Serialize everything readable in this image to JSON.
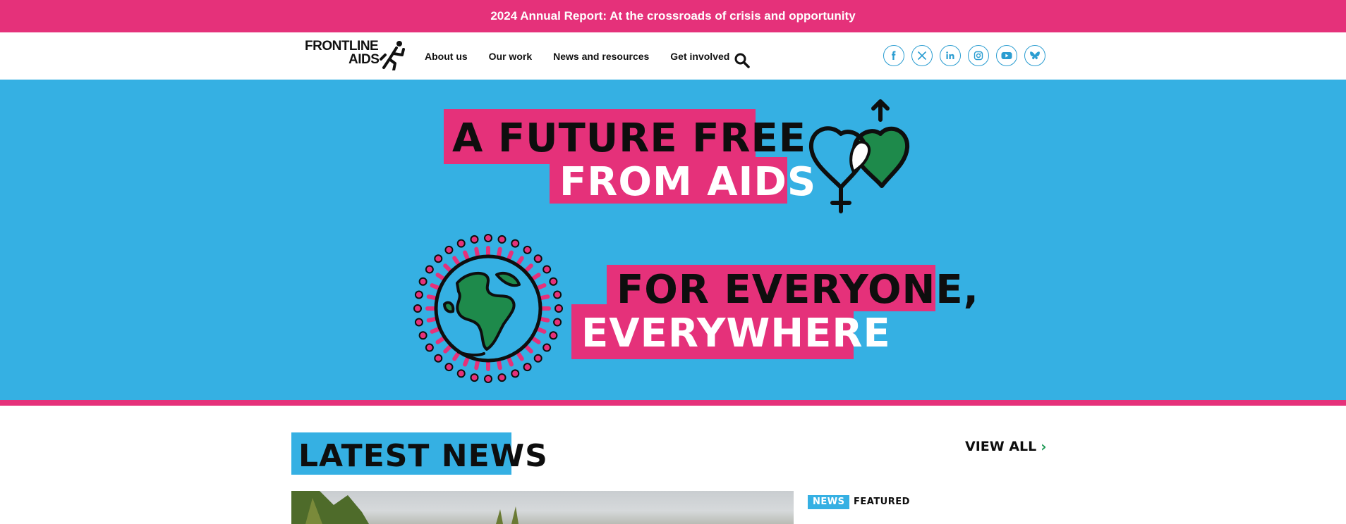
{
  "banner": {
    "text": "2024 Annual Report: At the crossroads of crisis and opportunity"
  },
  "header": {
    "logo": {
      "line1": "FRONTLINE",
      "line2": "AIDS"
    },
    "nav": [
      {
        "label": "About us"
      },
      {
        "label": "Our work"
      },
      {
        "label": "News and resources"
      },
      {
        "label": "Get involved"
      }
    ],
    "search_icon": "search-icon",
    "social": [
      {
        "icon": "facebook-icon"
      },
      {
        "icon": "x-icon"
      },
      {
        "icon": "linkedin-icon"
      },
      {
        "icon": "instagram-icon"
      },
      {
        "icon": "youtube-icon"
      },
      {
        "icon": "bluesky-icon"
      }
    ]
  },
  "hero": {
    "line1": "A FUTURE FREE",
    "line2": "FROM AIDS",
    "line3": "FOR EVERYONE,",
    "line4": "EVERYWHERE"
  },
  "news": {
    "title": "LATEST NEWS",
    "view_all": "VIEW ALL",
    "view_all_chevron": "›",
    "tag": "NEWS",
    "featured": "FEATURED"
  },
  "colors": {
    "pink": "#e5317a",
    "blue": "#35b0e3",
    "green": "#1e9a55",
    "black": "#0e0e0e"
  }
}
